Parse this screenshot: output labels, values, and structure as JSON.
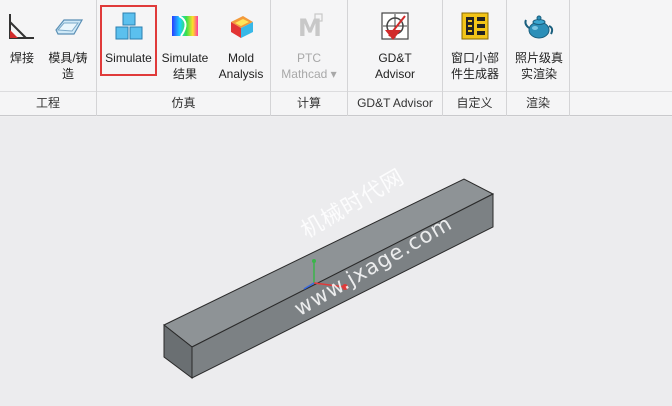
{
  "ribbon": {
    "groups": [
      {
        "label": "工程"
      },
      {
        "label": "仿真"
      },
      {
        "label": "计算"
      },
      {
        "label": "GD&T Advisor"
      },
      {
        "label": "自定义"
      },
      {
        "label": "渲染"
      }
    ],
    "buttons": {
      "weld": {
        "line1": "焊接",
        "line2": ""
      },
      "mold": {
        "line1": "模具/铸",
        "line2": "造"
      },
      "simulate": {
        "line1": "Simulate",
        "line2": ""
      },
      "simulate_results": {
        "line1": "Simulate",
        "line2": "结果"
      },
      "mold_analysis": {
        "line1": "Mold",
        "line2": "Analysis"
      },
      "mathcad": {
        "line1": "PTC",
        "line2": "Mathcad ▾"
      },
      "gdt": {
        "line1": "GD&T",
        "line2": "Advisor"
      },
      "widget": {
        "line1": "窗口小部",
        "line2": "件生成器"
      },
      "render": {
        "line1": "照片级真",
        "line2": "实渲染"
      }
    }
  },
  "viewport": {
    "watermark_line1": "机械时代网",
    "watermark_line2": "www.jxage.com"
  },
  "colors": {
    "highlight": "#e03a3a",
    "bar_front": "#7c8184",
    "bar_top": "#8e9396",
    "bar_side": "#5f6467"
  }
}
